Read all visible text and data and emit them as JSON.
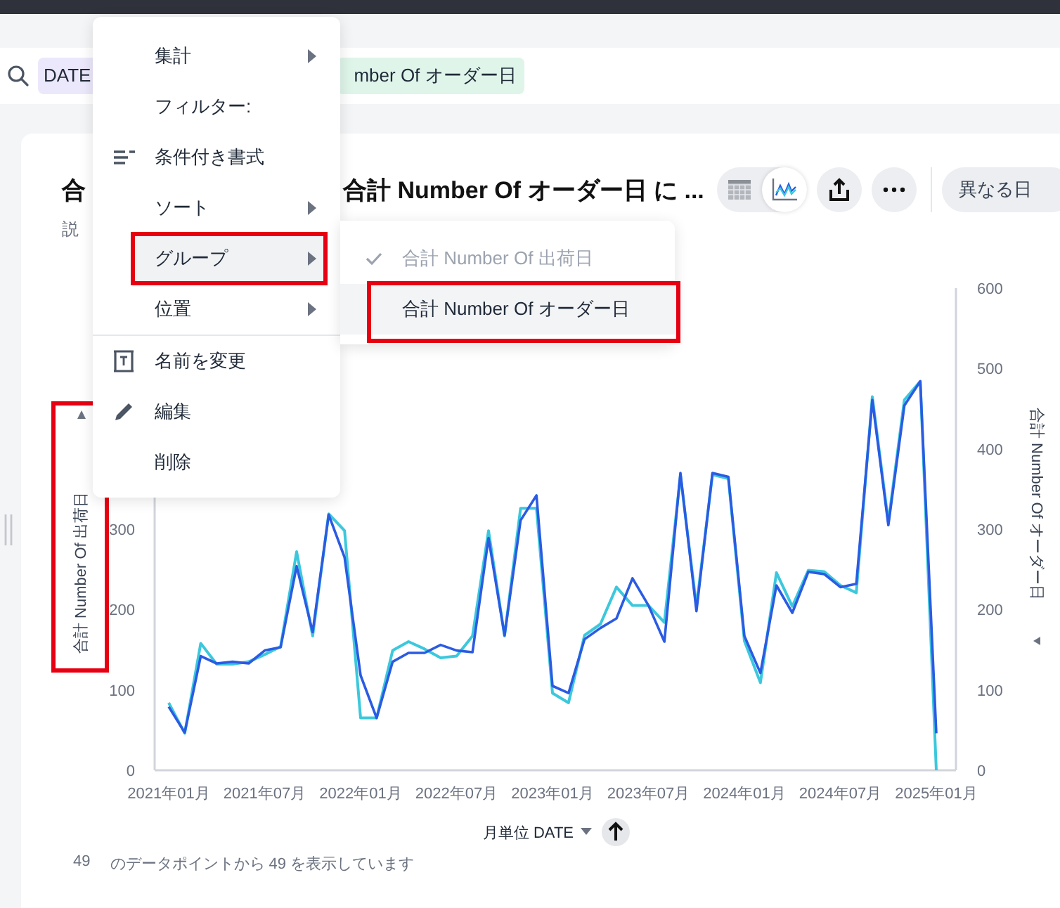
{
  "search_bar": {
    "chips": [
      {
        "label": "DATE",
        "color": "#ece8fb"
      },
      {
        "label": "mber Of オーダー日",
        "color": "#dff5ea"
      }
    ]
  },
  "card": {
    "title_parts": [
      "合",
      "合計 Number Of オーダー日 に ..."
    ],
    "description": "説",
    "view_toggle": [
      {
        "kind": "table",
        "selected": false
      },
      {
        "kind": "chart",
        "selected": true
      }
    ],
    "actions": [
      {
        "kind": "share"
      },
      {
        "kind": "more"
      }
    ],
    "filter_button": {
      "label": "異なる日"
    },
    "chart": {
      "left_axis_annotated": true,
      "chart_data": {
        "type": "line",
        "xlabel": "月単位 DATE",
        "ylabel": "合計 Number Of 出荷日",
        "y2label": "合計 Number Of オーダー日",
        "ylim": [
          0,
          600
        ],
        "y2lim": [
          0,
          600
        ],
        "yticks": [
          0,
          100,
          200,
          300
        ],
        "y2ticks": [
          0,
          100,
          200,
          300,
          400,
          500,
          600
        ],
        "categories": [
          "2021年01月",
          null,
          null,
          null,
          null,
          null,
          "2021年07月",
          null,
          null,
          null,
          null,
          null,
          "2022年01月",
          null,
          null,
          null,
          null,
          null,
          "2022年07月",
          null,
          null,
          null,
          null,
          null,
          "2023年01月",
          null,
          null,
          null,
          null,
          null,
          "2023年07月",
          null,
          null,
          null,
          null,
          null,
          "2024年01月",
          null,
          null,
          null,
          null,
          null,
          "2024年07月",
          null,
          null,
          null,
          null,
          null,
          "2025年01月"
        ],
        "series": [
          {
            "color": "#2b5be3",
            "values": [
              79,
              47,
              142,
              133,
              135,
              133,
              149,
              153,
              254,
              172,
              318,
              265,
              118,
              65,
              135,
              146,
              146,
              156,
              149,
              147,
              289,
              168,
              311,
              342,
              105,
              96,
              163,
              177,
              189,
              239,
              205,
              160,
              370,
              198,
              370,
              365,
              167,
              121,
              230,
              196,
              247,
              244,
              228,
              232,
              461,
              305,
              454,
              484,
              46
            ]
          },
          {
            "color": "#3cc8dc",
            "values": [
              84,
              46,
              158,
              132,
              132,
              135,
              144,
              154,
              272,
              167,
              319,
              298,
              65,
              65,
              149,
              160,
              151,
              140,
              142,
              167,
              298,
              167,
              326,
              326,
              96,
              84,
              168,
              182,
              228,
              205,
              205,
              184,
              367,
              204,
              368,
              363,
              161,
              109,
              246,
              204,
              249,
              247,
              230,
              221,
              465,
              309,
              461,
              484,
              0
            ]
          }
        ]
      }
    },
    "footer": {
      "count": "49",
      "text": "のデータポイントから 49 を表示しています"
    }
  },
  "context_menu": {
    "groups": [
      [
        {
          "label": "集計",
          "kind": "plain",
          "submenu": true,
          "selected": false,
          "annotated": false
        },
        {
          "label": "フィルター:",
          "kind": "plain",
          "submenu": false,
          "selected": false,
          "annotated": false
        },
        {
          "label": "条件付き書式",
          "kind": "lines",
          "submenu": false,
          "selected": false,
          "annotated": false
        },
        {
          "label": "ソート",
          "kind": "plain",
          "submenu": true,
          "selected": false,
          "annotated": false
        },
        {
          "label": "グループ",
          "kind": "plain",
          "submenu": true,
          "selected": true,
          "annotated": true
        },
        {
          "label": "位置",
          "kind": "plain",
          "submenu": true,
          "selected": false,
          "annotated": false
        }
      ],
      [
        {
          "label": "名前を変更",
          "kind": "rename",
          "submenu": false,
          "selected": false,
          "annotated": false
        },
        {
          "label": "編集",
          "kind": "pencil",
          "submenu": false,
          "selected": false,
          "annotated": false
        },
        {
          "label": "削除",
          "kind": "plain",
          "submenu": false,
          "selected": false,
          "annotated": false
        }
      ]
    ]
  },
  "submenu": {
    "items": [
      {
        "label": "合計 Number Of 出荷日",
        "checked": true,
        "selected": false,
        "annotated": false
      },
      {
        "label": "合計 Number Of オーダー日",
        "checked": false,
        "selected": true,
        "annotated": true
      }
    ]
  }
}
